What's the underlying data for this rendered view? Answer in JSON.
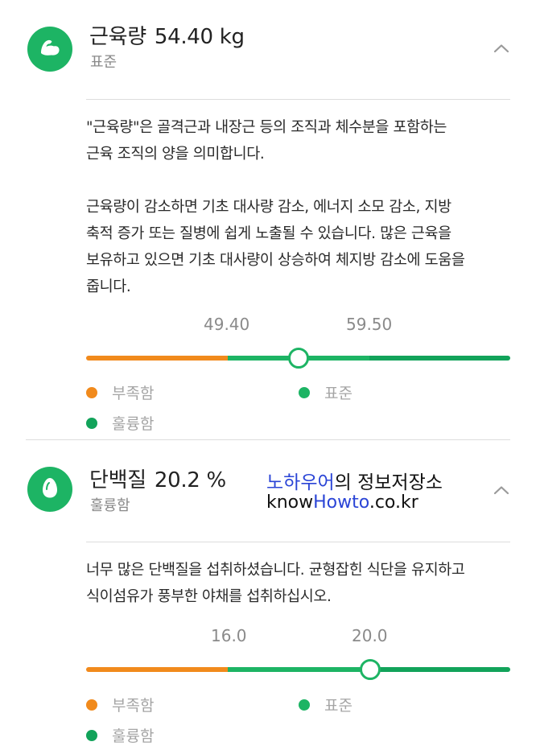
{
  "colors": {
    "low": "#f18a1c",
    "normal": "#1db464",
    "high": "#1db464",
    "watermark_blue": "#2a44d6"
  },
  "muscle": {
    "icon": "flexed-arm-icon",
    "label": "근육량",
    "value": "54.40 kg",
    "status": "표준",
    "description": [
      "\"근육량\"은 골격근과 내장근 등의 조직과 체수분을 포함하는",
      "근육 조직의 양을 의미합니다.",
      "",
      "근육량이 감소하면 기초 대사량 감소, 에너지 소모 감소, 지방",
      "축적 증가 또는 질병에 쉽게 노출될 수 있습니다. 많은 근육을",
      "보유하고 있으면 기초 대사량이 상승하여 체지방 감소에 도움을",
      "줍니다."
    ],
    "range_low": "49.40",
    "range_high": "59.50",
    "level": 0.5,
    "legend": {
      "low": "부족함",
      "normal": "표준",
      "high": "훌륭함"
    }
  },
  "protein": {
    "icon": "egg-icon",
    "label": "단백질",
    "value": "20.2 %",
    "status": "훌륭함",
    "description": [
      "너무 많은 단백질을 섭취하셨습니다. 균형잡힌 식단을 유지하고",
      "식이섬유가 풍부한 야채를 섭취하십시오."
    ],
    "range_low": "16.0",
    "range_high": "20.0",
    "level": 0.67,
    "legend": {
      "low": "부족함",
      "normal": "표준",
      "high": "훌륭함"
    }
  },
  "watermark": {
    "line1_blue": "노하우어",
    "line1_rest": "의 정보저장소",
    "line2_a": "know",
    "line2_blue": "Howto",
    "line2_b": ".co.kr"
  }
}
